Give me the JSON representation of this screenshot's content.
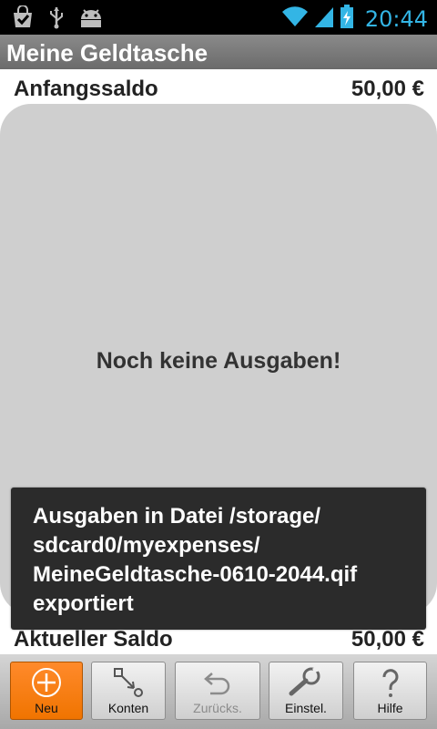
{
  "status_bar": {
    "time": "20:44",
    "icons": [
      "shopping-bag-icon",
      "usb-icon",
      "android-icon",
      "wifi-icon",
      "signal-icon",
      "battery-charging-icon"
    ]
  },
  "header": {
    "title": "Meine Geldtasche"
  },
  "opening_balance": {
    "label": "Anfangssaldo",
    "value": "50,00 €"
  },
  "list": {
    "empty_text": "Noch keine Ausgaben!"
  },
  "toast": {
    "message": "Ausgaben in Datei /storage/\nsdcard0/myexpenses/\nMeineGeldtasche-0610-2044.qif\nexportiert"
  },
  "current_balance": {
    "label": "Aktueller Saldo",
    "value": "50,00 €"
  },
  "toolbar": {
    "new_label": "Neu",
    "accounts_label": "Konten",
    "back_label": "Zurücks.",
    "settings_label": "Einstel.",
    "help_label": "Hilfe"
  },
  "colors": {
    "accent": "#f07400",
    "time": "#33b5e5",
    "title_bar": "#777777",
    "panel": "#cfcfcf"
  }
}
